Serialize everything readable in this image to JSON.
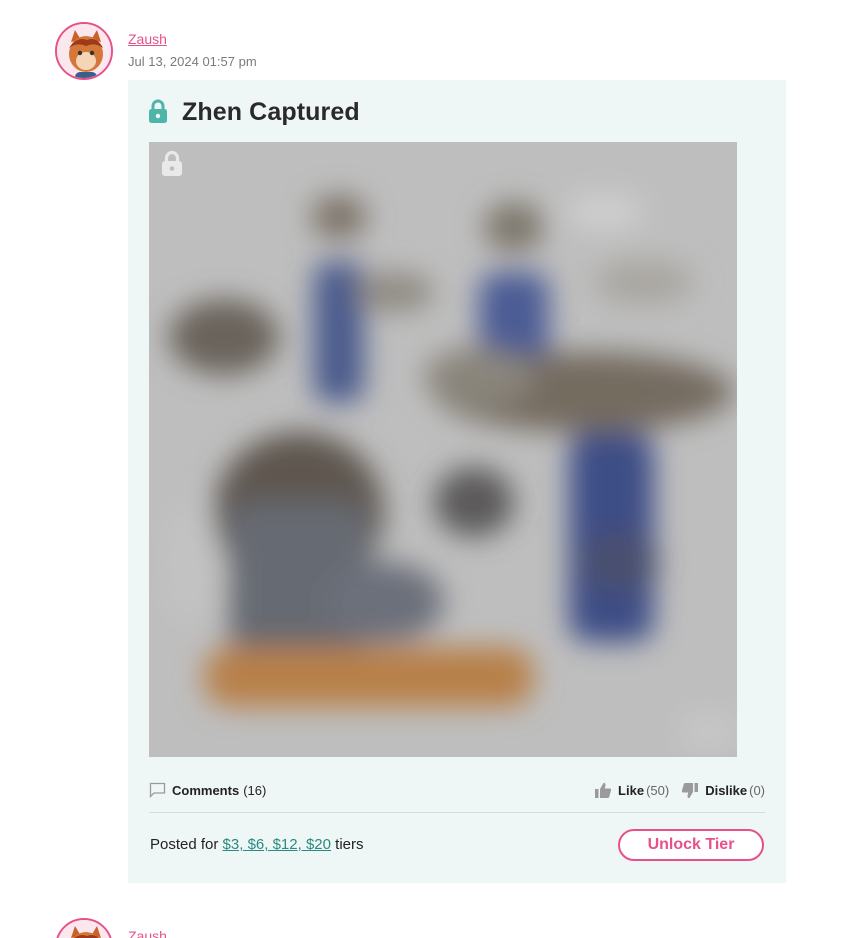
{
  "post": {
    "author": "Zaush",
    "date": "Jul 13, 2024 01:57 pm",
    "title": "Zhen Captured",
    "comments_label": "Comments",
    "comments_count": "(16)",
    "like_label": "Like",
    "like_count": "(50)",
    "dislike_label": "Dislike",
    "dislike_count": "(0)",
    "posted_prefix": "Posted for",
    "tiers_link": "$3, $6, $12, $20",
    "posted_suffix": "tiers",
    "unlock_button": "Unlock Tier"
  },
  "next_post": {
    "author": "Zaush"
  },
  "icons": {
    "title_lock": "lock-icon",
    "media_lock": "lock-icon",
    "comments": "comment-icon",
    "like": "thumbs-up-icon",
    "dislike": "thumbs-down-icon"
  },
  "colors": {
    "accent": "#e8508a",
    "link_teal": "#2a8a84",
    "lock_teal": "#4fb5a8",
    "card_bg": "#eff7f6"
  }
}
